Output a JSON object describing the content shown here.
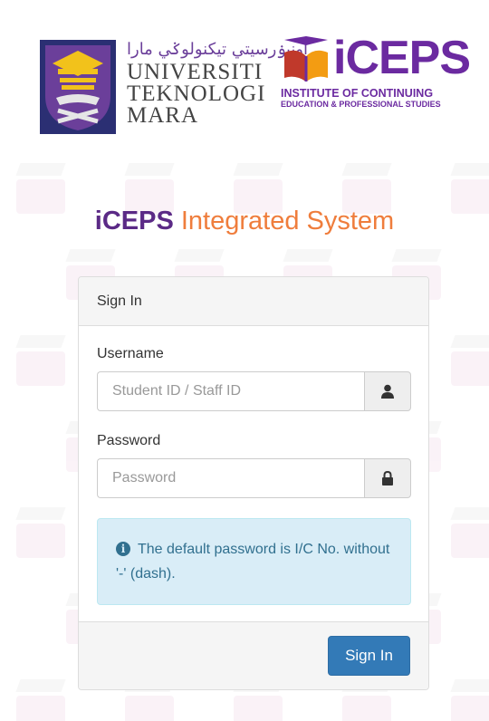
{
  "logos": {
    "uitm": {
      "jawi": "اونيۏرسيتي تيکنولوݢي مارا",
      "line1": "UNIVERSITI",
      "line2": "TEKNOLOGI",
      "line3": "MARA"
    },
    "iceps": {
      "word": "iCEPS",
      "subtitle1": "INSTITUTE OF CONTINUING",
      "subtitle2": "EDUCATION & PROFESSIONAL STUDIES"
    }
  },
  "title": {
    "part1": "iCEPS",
    "part2": "Integrated System"
  },
  "panel": {
    "heading": "Sign In",
    "username_label": "Username",
    "username_placeholder": "Student ID / Staff ID",
    "username_icon": "user-icon",
    "password_label": "Password",
    "password_placeholder": "Password",
    "password_icon": "lock-icon",
    "alert_text": "The default password is I/C No. without '-' (dash).",
    "alert_icon": "info-icon",
    "submit_label": "Sign In"
  },
  "colors": {
    "brand_purple": "#5b2a86",
    "brand_orange": "#ef7d3c",
    "primary_button": "#337ab7",
    "alert_bg": "#d9edf7",
    "alert_text": "#31708f"
  }
}
